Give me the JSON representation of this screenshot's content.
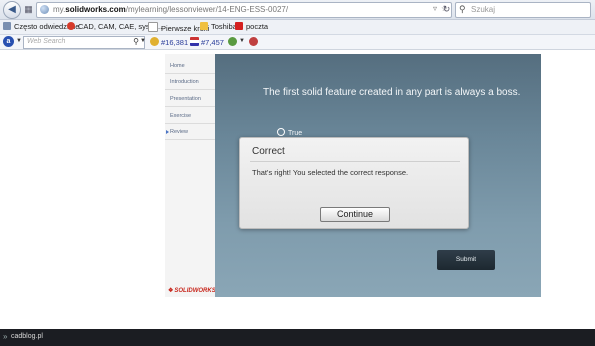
{
  "browser": {
    "url_prefix": "my.",
    "url_domain": "solidworks.com",
    "url_path": "/mylearning/lessonviewer/14-ENG-ESS-0027/",
    "search_placeholder": "Szukaj",
    "bookmarks": [
      {
        "label": "Często odwiedzane",
        "color": "#7a8fb0"
      },
      {
        "label": "CAD, CAM, CAE, syste...",
        "color": "#d63a2a"
      },
      {
        "label": "Pierwsze kroki",
        "color": "#ffffff"
      },
      {
        "label": "Toshiba",
        "color": "#f0c040"
      },
      {
        "label": "poczta",
        "color": "#d42020"
      }
    ],
    "toolbar": {
      "web_search_placeholder": "Web Search",
      "counter_1": "#16,381",
      "counter_2": "#7,457"
    }
  },
  "lesson": {
    "sidebar": [
      {
        "label": "Home"
      },
      {
        "label": "Introduction"
      },
      {
        "label": "Presentation"
      },
      {
        "label": "Exercise"
      },
      {
        "label": "Review"
      }
    ],
    "brand": "SOLIDWORKS",
    "question": "The first solid feature created in any part is always a boss.",
    "option_true": "True",
    "submit_label": "Submit"
  },
  "dialog": {
    "title": "Correct",
    "message": "That's right!  You selected the correct response.",
    "button": "Continue"
  },
  "footer": {
    "text": "cadblog.pl"
  },
  "colors": {
    "stage": "#6a8799",
    "submit": "#25323c",
    "brand_red": "#c8281e"
  }
}
